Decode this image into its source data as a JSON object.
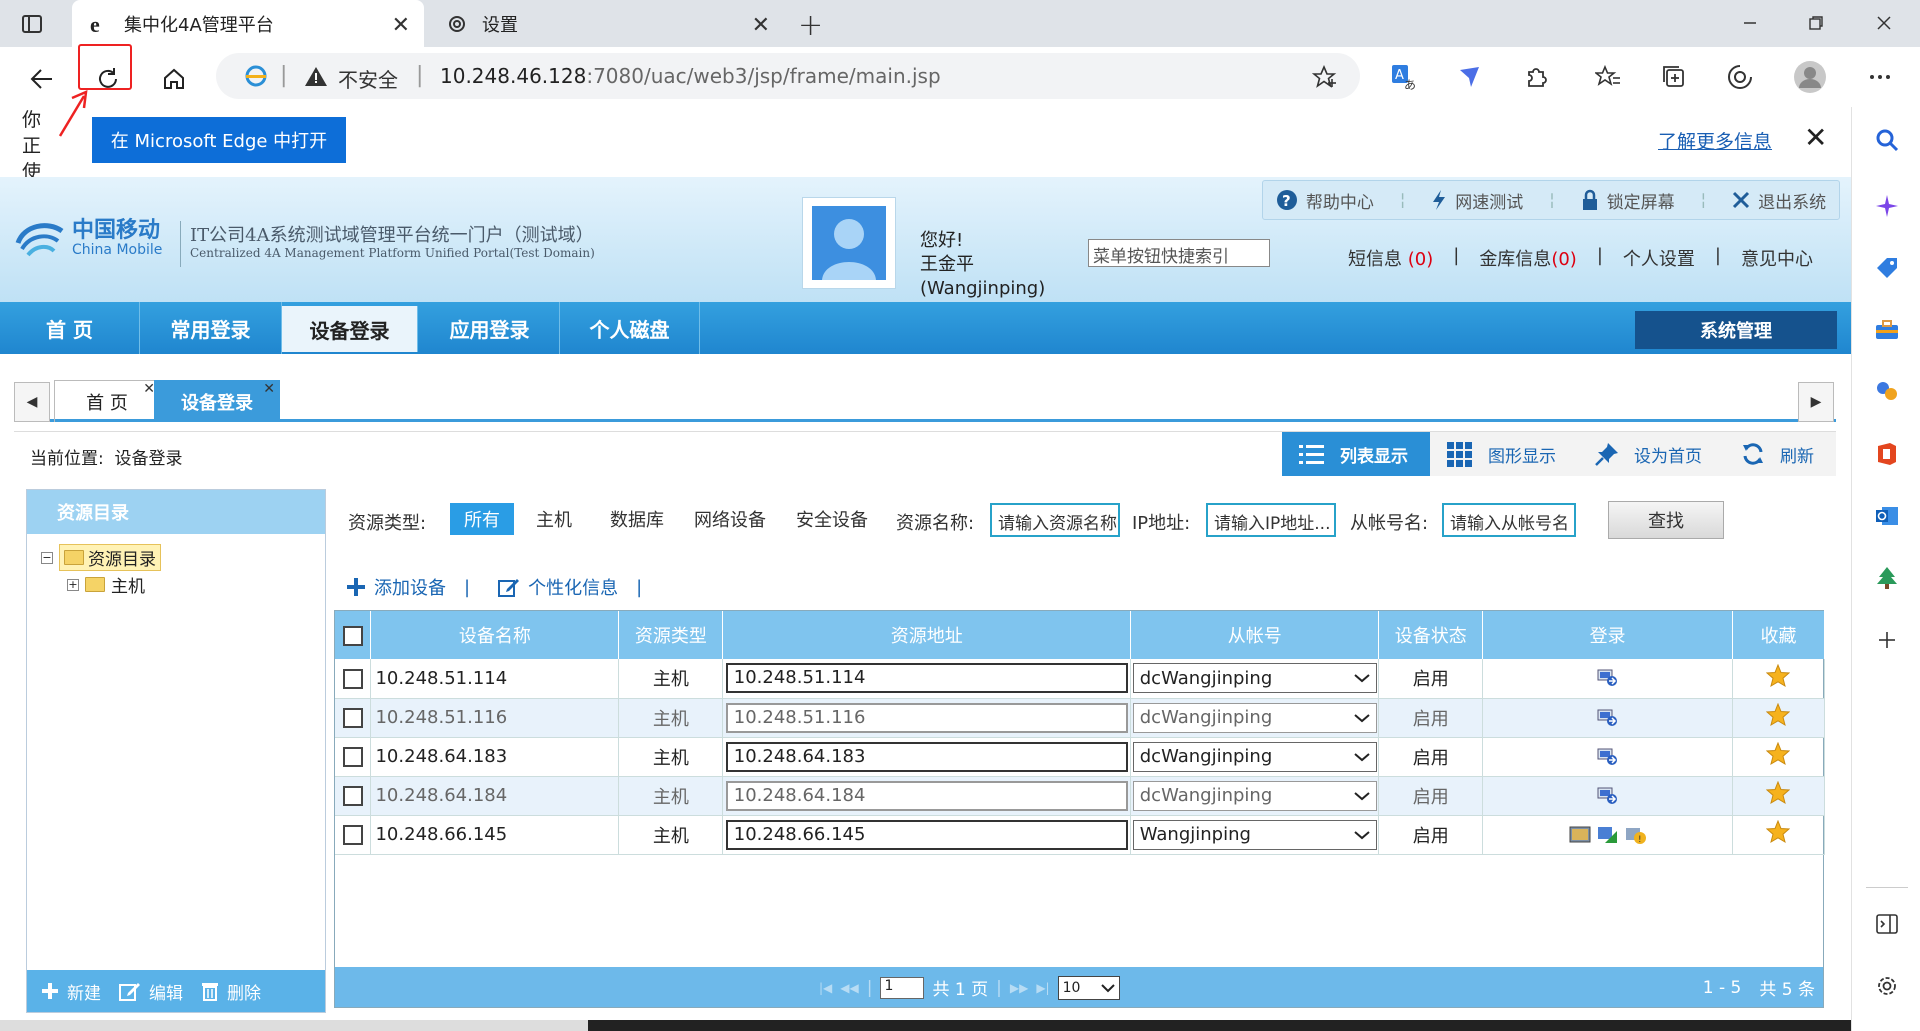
{
  "browser": {
    "tabs": [
      {
        "title": "集中化4A管理平台"
      },
      {
        "title": "设置"
      }
    ],
    "address": {
      "insecure_label": "不安全",
      "url_host": "10.248.46.128",
      "url_rest": ":7080/uac/web3/jsp/frame/main.jsp"
    },
    "infobar": {
      "you_text": "你正使",
      "open_button": "在 Microsoft Edge 中打开",
      "learn_more": "了解更多信息"
    }
  },
  "header": {
    "logo_cn": "中国移动",
    "logo_en": "China Mobile",
    "portal_title": "IT公司4A系统测试域管理平台统一门户（测试域）",
    "portal_subtitle": "Centralized 4A Management Platform Unified Portal(Test Domain)",
    "greeting": "您好!",
    "user_name": "王金平",
    "user_id": "(Wangjinping)",
    "quick_search": "菜单按钮快捷索引",
    "top_links": [
      "帮助中心",
      "网速测试",
      "锁定屏幕",
      "退出系统"
    ],
    "user_links": {
      "messages": "短信息",
      "messages_count": "(0)",
      "vault": "金库信息",
      "vault_count": "(0)",
      "settings": "个人设置",
      "feedback": "意见中心",
      "sep": "|"
    }
  },
  "main_nav": {
    "items": [
      "首 页",
      "常用登录",
      "设备登录",
      "应用登录",
      "个人磁盘"
    ],
    "active_index": 2,
    "system_admin": "系统管理"
  },
  "inner_tabs": [
    {
      "label": "首 页"
    },
    {
      "label": "设备登录",
      "active": true
    }
  ],
  "location": {
    "label": "当前位置:",
    "value": "设备登录",
    "tools": [
      "列表显示",
      "图形显示",
      "设为首页",
      "刷新"
    ]
  },
  "resource_tree": {
    "header": "资源目录",
    "root": "资源目录",
    "child": "主机",
    "footer": [
      "新建",
      "编辑",
      "删除"
    ]
  },
  "filters": {
    "type_label": "资源类型:",
    "types": [
      "所有",
      "主机",
      "数据库",
      "网络设备",
      "安全设备"
    ],
    "active_type": "所有",
    "name_label": "资源名称:",
    "name_placeholder": "请输入资源名称",
    "ip_label": "IP地址:",
    "ip_placeholder": "请输入IP地址...",
    "account_label": "从帐号名:",
    "account_placeholder": "请输入从帐号名",
    "search_button": "查找"
  },
  "actions": {
    "add_device": "添加设备",
    "personalize": "个性化信息",
    "sep": "|"
  },
  "table": {
    "columns": [
      "设备名称",
      "资源类型",
      "资源地址",
      "从帐号",
      "设备状态",
      "登录",
      "收藏"
    ],
    "rows": [
      {
        "name": "10.248.51.114",
        "type": "主机",
        "address": "10.248.51.114",
        "account": "dcWangjinping",
        "status": "启用"
      },
      {
        "name": "10.248.51.116",
        "type": "主机",
        "address": "10.248.51.116",
        "account": "dcWangjinping",
        "status": "启用"
      },
      {
        "name": "10.248.64.183",
        "type": "主机",
        "address": "10.248.64.183",
        "account": "dcWangjinping",
        "status": "启用"
      },
      {
        "name": "10.248.64.184",
        "type": "主机",
        "address": "10.248.64.184",
        "account": "dcWangjinping",
        "status": "启用"
      },
      {
        "name": "10.248.66.145",
        "type": "主机",
        "address": "10.248.66.145",
        "account": "Wangjinping",
        "status": "启用"
      }
    ]
  },
  "pager": {
    "page": "1",
    "total_pages": "共 1 页",
    "page_size": "10",
    "range": "1 - 5",
    "total": "共 5 条"
  },
  "colors": {
    "nav_blue": "#1f86cf",
    "header_bg": "#bfe1f5",
    "table_header": "#7fc4ee",
    "edge_button": "#0d6ed8",
    "highlight_red": "#e22222"
  }
}
